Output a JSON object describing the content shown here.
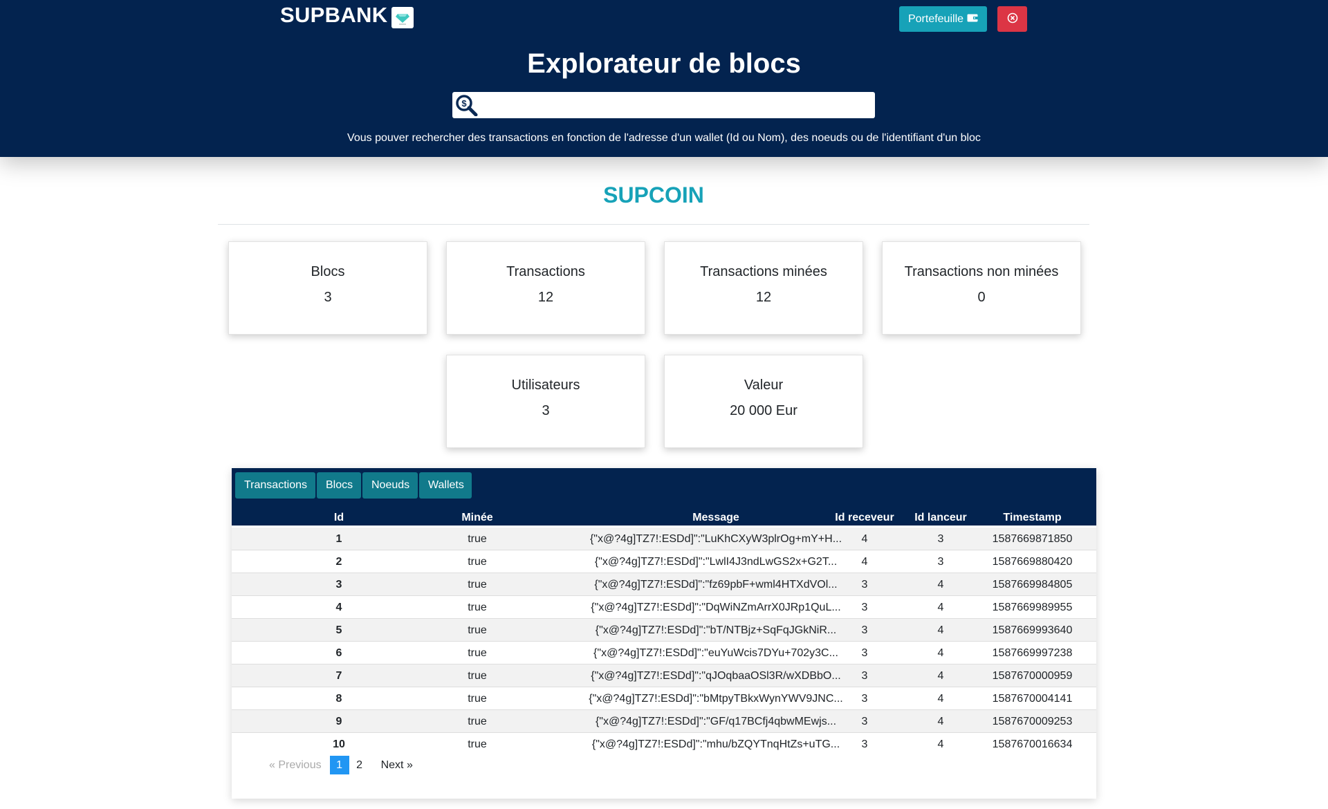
{
  "header": {
    "brand": "SUPBANK",
    "wallet_button": "Portefeuille",
    "title": "Explorateur de blocs",
    "search_placeholder": "",
    "hint": "Vous pouver rechercher des transactions en fonction de l'adresse d'un wallet (Id ou Nom), des noeuds ou de l'identifiant d'un bloc"
  },
  "section": {
    "title": "SUPCOIN"
  },
  "stats": [
    {
      "label": "Blocs",
      "value": "3"
    },
    {
      "label": "Transactions",
      "value": "12"
    },
    {
      "label": "Transactions minées",
      "value": "12"
    },
    {
      "label": "Transactions non minées",
      "value": "0"
    },
    {
      "label": "Utilisateurs",
      "value": "3"
    },
    {
      "label": "Valeur",
      "value": "20 000 Eur"
    }
  ],
  "tabs": [
    "Transactions",
    "Blocs",
    "Noeuds",
    "Wallets"
  ],
  "table": {
    "headers": [
      "Id",
      "Minée",
      "Message",
      "Id receveur",
      "Id lanceur",
      "Timestamp"
    ],
    "rows": [
      {
        "id": "1",
        "mined": "true",
        "message": "{\"x@?4g]TZ7!:ESDd]\":\"LuKhCXyW3plrOg+mY+H...",
        "receiver": "4",
        "sender": "3",
        "timestamp": "1587669871850"
      },
      {
        "id": "2",
        "mined": "true",
        "message": "{\"x@?4g]TZ7!:ESDd]\":\"LwlI4J3ndLwGS2x+G2T...",
        "receiver": "4",
        "sender": "3",
        "timestamp": "1587669880420"
      },
      {
        "id": "3",
        "mined": "true",
        "message": "{\"x@?4g]TZ7!:ESDd]\":\"fz69pbF+wml4HTXdVOl...",
        "receiver": "3",
        "sender": "4",
        "timestamp": "1587669984805"
      },
      {
        "id": "4",
        "mined": "true",
        "message": "{\"x@?4g]TZ7!:ESDd]\":\"DqWiNZmArrX0JRp1QuL...",
        "receiver": "3",
        "sender": "4",
        "timestamp": "1587669989955"
      },
      {
        "id": "5",
        "mined": "true",
        "message": "{\"x@?4g]TZ7!:ESDd]\":\"bT/NTBjz+SqFqJGkNiR...",
        "receiver": "3",
        "sender": "4",
        "timestamp": "1587669993640"
      },
      {
        "id": "6",
        "mined": "true",
        "message": "{\"x@?4g]TZ7!:ESDd]\":\"euYuWcis7DYu+702y3C...",
        "receiver": "3",
        "sender": "4",
        "timestamp": "1587669997238"
      },
      {
        "id": "7",
        "mined": "true",
        "message": "{\"x@?4g]TZ7!:ESDd]\":\"qJOqbaaOSl3R/wXDBbO...",
        "receiver": "3",
        "sender": "4",
        "timestamp": "1587670000959"
      },
      {
        "id": "8",
        "mined": "true",
        "message": "{\"x@?4g]TZ7!:ESDd]\":\"bMtpyTBkxWynYWV9JNC...",
        "receiver": "3",
        "sender": "4",
        "timestamp": "1587670004141"
      },
      {
        "id": "9",
        "mined": "true",
        "message": "{\"x@?4g]TZ7!:ESDd]\":\"GF/q17BCfj4qbwMEwjs...",
        "receiver": "3",
        "sender": "4",
        "timestamp": "1587670009253"
      },
      {
        "id": "10",
        "mined": "true",
        "message": "{\"x@?4g]TZ7!:ESDd]\":\"mhu/bZQYTnqHtZs+uTG...",
        "receiver": "3",
        "sender": "4",
        "timestamp": "1587670016634"
      }
    ]
  },
  "pagination": {
    "previous": "«  Previous",
    "pages": [
      "1",
      "2"
    ],
    "next": "Next  »",
    "current": "1"
  },
  "colors": {
    "navy": "#03234f",
    "teal": "#17a2b8",
    "red": "#dc3545",
    "page_active": "#2196f3"
  }
}
